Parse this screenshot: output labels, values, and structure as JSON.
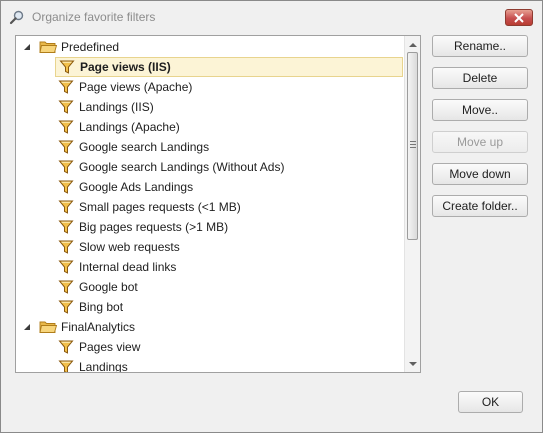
{
  "dialog": {
    "title": "Organize favorite filters",
    "ok_label": "OK"
  },
  "buttons": {
    "rename": "Rename..",
    "delete": "Delete",
    "move": "Move..",
    "move_up": "Move up",
    "move_down": "Move down",
    "create_folder": "Create folder.."
  },
  "tree": {
    "folders": [
      {
        "name": "Predefined",
        "items": [
          "Page views (IIS)",
          "Page views (Apache)",
          "Landings (IIS)",
          "Landings (Apache)",
          "Google search Landings",
          "Google search Landings (Without Ads)",
          "Google Ads Landings",
          "Small pages requests (<1 MB)",
          "Big pages requests (>1 MB)",
          "Slow web requests",
          "Internal dead links",
          "Google bot",
          "Bing bot"
        ]
      },
      {
        "name": "FinalAnalytics",
        "items": [
          "Pages view",
          "Landings"
        ]
      }
    ],
    "selected_item": "Page views (IIS)"
  },
  "colors": {
    "selection_bg": "#fcf4d6",
    "close_button": "#c75050"
  }
}
